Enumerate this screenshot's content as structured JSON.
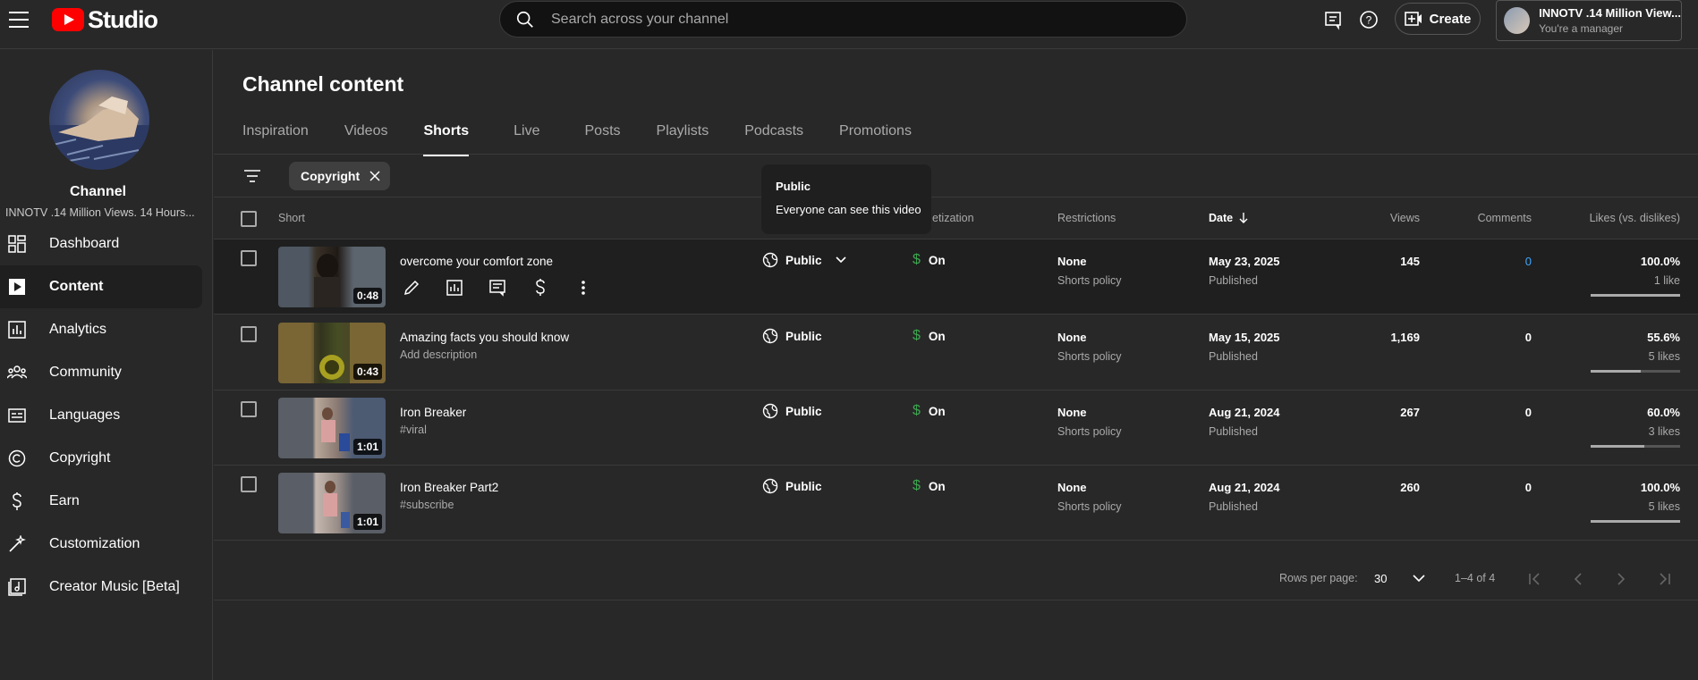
{
  "header": {
    "logo_text": "Studio",
    "search_placeholder": "Search across your channel",
    "create_label": "Create",
    "account_name": "INNOTV .14 Million View...",
    "account_role": "You're a manager"
  },
  "sidebar": {
    "channel_label": "Channel",
    "channel_name": "INNOTV .14 Million Views. 14 Hours...",
    "items": [
      {
        "label": "Dashboard",
        "icon": "dashboard-icon"
      },
      {
        "label": "Content",
        "icon": "content-icon",
        "active": true
      },
      {
        "label": "Analytics",
        "icon": "analytics-icon"
      },
      {
        "label": "Community",
        "icon": "community-icon"
      },
      {
        "label": "Languages",
        "icon": "languages-icon"
      },
      {
        "label": "Copyright",
        "icon": "copyright-icon"
      },
      {
        "label": "Earn",
        "icon": "earn-icon"
      },
      {
        "label": "Customization",
        "icon": "customization-icon"
      },
      {
        "label": "Creator Music [Beta]",
        "icon": "creator-music-icon"
      }
    ]
  },
  "main": {
    "title": "Channel content",
    "tabs": [
      "Inspiration",
      "Videos",
      "Shorts",
      "Live",
      "Posts",
      "Playlists",
      "Podcasts",
      "Promotions"
    ],
    "active_tab": "Shorts",
    "filter_chip": "Copyright",
    "columns": {
      "short": "Short",
      "monetization": "etization",
      "restrictions": "Restrictions",
      "date": "Date",
      "views": "Views",
      "comments": "Comments",
      "likes": "Likes (vs. dislikes)"
    },
    "tooltip": {
      "title": "Public",
      "text": "Everyone can see this video"
    },
    "rows": [
      {
        "duration": "0:48",
        "title": "overcome your comfort zone",
        "description": "",
        "visibility": "Public",
        "monetization": "On",
        "restriction": "None",
        "restriction_sub": "Shorts policy",
        "date": "May 23, 2025",
        "status": "Published",
        "views": "145",
        "comments": "0",
        "likes_pct": "100.0%",
        "likes_count": "1 like",
        "likes_ratio": 1.0
      },
      {
        "duration": "0:43",
        "title": "Amazing facts you should know",
        "description": "Add description",
        "visibility": "Public",
        "monetization": "On",
        "restriction": "None",
        "restriction_sub": "Shorts policy",
        "date": "May 15, 2025",
        "status": "Published",
        "views": "1,169",
        "comments": "0",
        "likes_pct": "55.6%",
        "likes_count": "5 likes",
        "likes_ratio": 0.556
      },
      {
        "duration": "1:01",
        "title": "Iron Breaker",
        "description": "#viral",
        "visibility": "Public",
        "monetization": "On",
        "restriction": "None",
        "restriction_sub": "Shorts policy",
        "date": "Aug 21, 2024",
        "status": "Published",
        "views": "267",
        "comments": "0",
        "likes_pct": "60.0%",
        "likes_count": "3 likes",
        "likes_ratio": 0.6
      },
      {
        "duration": "1:01",
        "title": "Iron Breaker Part2",
        "description": "#subscribe",
        "visibility": "Public",
        "monetization": "On",
        "restriction": "None",
        "restriction_sub": "Shorts policy",
        "date": "Aug 21, 2024",
        "status": "Published",
        "views": "260",
        "comments": "0",
        "likes_pct": "100.0%",
        "likes_count": "5 likes",
        "likes_ratio": 1.0
      }
    ],
    "pagination": {
      "rows_per_page_label": "Rows per page:",
      "rows_per_page": "30",
      "range": "1–4 of 4"
    }
  },
  "colors": {
    "background": "#282828",
    "accent_blue": "#3ea6ff",
    "money_green": "#3ea650",
    "brand_red": "#ff0000"
  }
}
